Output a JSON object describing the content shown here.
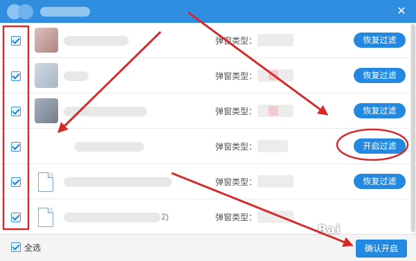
{
  "window": {
    "close_glyph": "✕"
  },
  "rows": [
    {
      "type_label": "弹窗类型：",
      "action_label": "恢复过滤",
      "icon": "app-icon",
      "icon_color": "#c79f98"
    },
    {
      "type_label": "弹窗类型：",
      "action_label": "恢复过滤",
      "icon": "app-icon",
      "icon_color": "#b7c3d3"
    },
    {
      "type_label": "弹窗类型：",
      "action_label": "恢复过滤",
      "icon": "app-icon",
      "icon_color": "#8e99a8"
    },
    {
      "type_label": "弹窗类型：",
      "action_label": "开启过滤",
      "icon": "none",
      "icon_color": ""
    },
    {
      "type_label": "弹窗类型：",
      "action_label": "恢复过滤",
      "icon": "file-icon",
      "icon_color": "#7aa6d6"
    },
    {
      "name_visible": "2)",
      "type_label": "弹窗类型：",
      "action_label": "",
      "icon": "file-icon",
      "icon_color": "#7aa6d6"
    }
  ],
  "footer": {
    "select_all_label": "全选",
    "confirm_label": "确认开启"
  },
  "watermark": {
    "text": "Bai"
  },
  "colors": {
    "accent": "#2389e0",
    "titlebar": "#2f8ee0",
    "annotation": "#d42a2a"
  }
}
